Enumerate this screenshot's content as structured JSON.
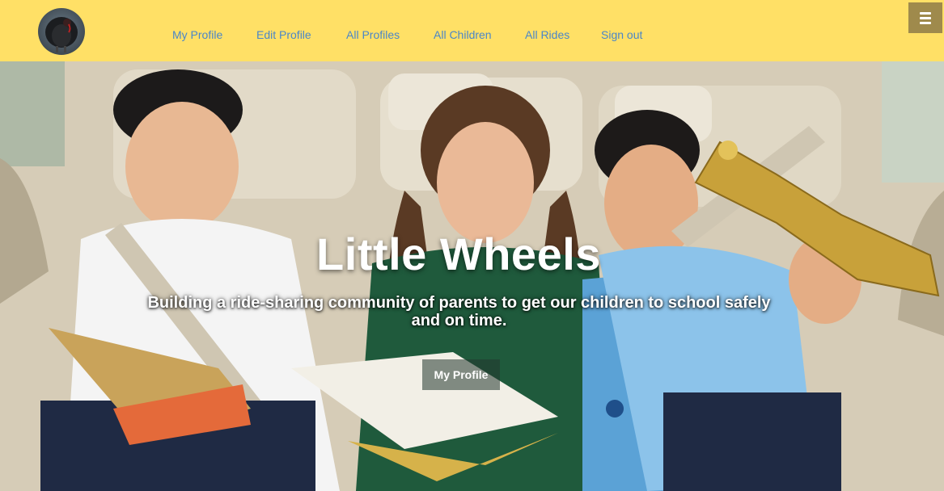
{
  "nav": {
    "logo_alt": "turkey-logo",
    "links": [
      "My Profile",
      "Edit Profile",
      "All Profiles",
      "All Children",
      "All Rides",
      "Sign out"
    ],
    "menu_icon": "hamburger-icon",
    "colors": {
      "background": "#ffe066",
      "link": "#4a86c8",
      "menu_button": "#9f8a4c"
    }
  },
  "hero": {
    "title": "Little Wheels",
    "subtitle": "Building a ride-sharing community of parents to get our children to school safely and on time.",
    "button_label": "My Profile"
  }
}
